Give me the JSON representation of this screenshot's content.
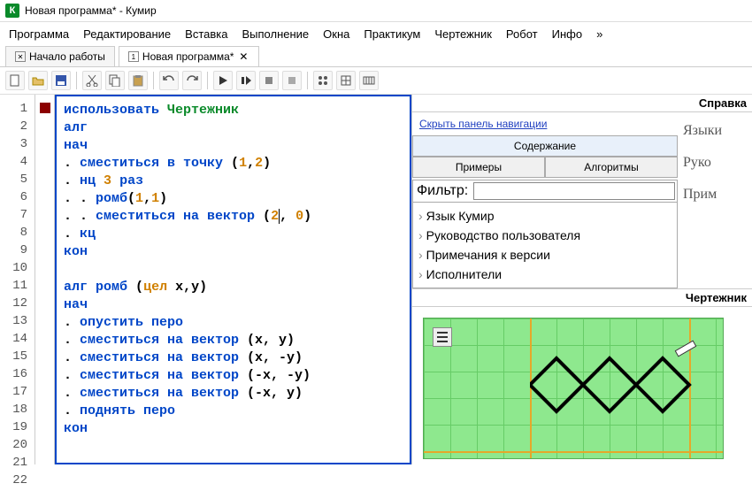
{
  "window": {
    "icon": "К",
    "title": "Новая программа* - Кумир"
  },
  "menu": [
    "Программа",
    "Редактирование",
    "Вставка",
    "Выполнение",
    "Окна",
    "Практикум",
    "Чертежник",
    "Робот",
    "Инфо",
    "»"
  ],
  "tabs": [
    {
      "icon": "✕",
      "label": "Начало работы",
      "active": false,
      "closable": false
    },
    {
      "icon": "1",
      "label": "Новая программа*",
      "active": true,
      "closable": true
    }
  ],
  "toolbar_icons": [
    "new",
    "open",
    "save",
    "cut",
    "copy",
    "paste",
    "undo",
    "redo",
    "run",
    "step",
    "stop",
    "stop2",
    "breakpoints",
    "vars",
    "counter"
  ],
  "editor": {
    "line_count": 22,
    "lines": [
      [
        {
          "t": "использовать",
          "c": "kw"
        },
        {
          "t": " ",
          "c": ""
        },
        {
          "t": "Чертежник",
          "c": "actor"
        }
      ],
      [
        {
          "t": "алг",
          "c": "kw"
        }
      ],
      [
        {
          "t": "нач",
          "c": "kw"
        }
      ],
      [
        {
          "t": ". ",
          "c": "pun"
        },
        {
          "t": "сместиться в точку",
          "c": "kw"
        },
        {
          "t": " (",
          "c": "pun"
        },
        {
          "t": "1",
          "c": "num"
        },
        {
          "t": ",",
          "c": "pun"
        },
        {
          "t": "2",
          "c": "num"
        },
        {
          "t": ")",
          "c": "pun"
        }
      ],
      [
        {
          "t": ". ",
          "c": "pun"
        },
        {
          "t": "нц",
          "c": "kw"
        },
        {
          "t": " ",
          "c": ""
        },
        {
          "t": "3",
          "c": "num"
        },
        {
          "t": " ",
          "c": ""
        },
        {
          "t": "раз",
          "c": "kw"
        }
      ],
      [
        {
          "t": ". . ",
          "c": "pun"
        },
        {
          "t": "ромб",
          "c": "kw"
        },
        {
          "t": "(",
          "c": "pun"
        },
        {
          "t": "1",
          "c": "num"
        },
        {
          "t": ",",
          "c": "pun"
        },
        {
          "t": "1",
          "c": "num"
        },
        {
          "t": ")",
          "c": "pun"
        }
      ],
      [
        {
          "t": ". . ",
          "c": "pun"
        },
        {
          "t": "сместиться на вектор",
          "c": "kw"
        },
        {
          "t": " (",
          "c": "pun"
        },
        {
          "t": "2",
          "c": "num cursor"
        },
        {
          "t": ", ",
          "c": "pun"
        },
        {
          "t": "0",
          "c": "num"
        },
        {
          "t": ")",
          "c": "pun"
        }
      ],
      [
        {
          "t": ". ",
          "c": "pun"
        },
        {
          "t": "кц",
          "c": "kw"
        }
      ],
      [
        {
          "t": "кон",
          "c": "kw"
        }
      ],
      [],
      [
        {
          "t": "алг",
          "c": "kw"
        },
        {
          "t": " ",
          "c": ""
        },
        {
          "t": "ромб",
          "c": "kw"
        },
        {
          "t": " (",
          "c": "pun"
        },
        {
          "t": "цел",
          "c": "type"
        },
        {
          "t": " x,y)",
          "c": "pun"
        }
      ],
      [
        {
          "t": "нач",
          "c": "kw"
        }
      ],
      [
        {
          "t": ". ",
          "c": "pun"
        },
        {
          "t": "опустить перо",
          "c": "kw"
        }
      ],
      [
        {
          "t": ". ",
          "c": "pun"
        },
        {
          "t": "сместиться на вектор",
          "c": "kw"
        },
        {
          "t": " (x, y)",
          "c": "pun"
        }
      ],
      [
        {
          "t": ". ",
          "c": "pun"
        },
        {
          "t": "сместиться на вектор",
          "c": "kw"
        },
        {
          "t": " (x, -y)",
          "c": "pun"
        }
      ],
      [
        {
          "t": ". ",
          "c": "pun"
        },
        {
          "t": "сместиться на вектор",
          "c": "kw"
        },
        {
          "t": " (-x, -y)",
          "c": "pun"
        }
      ],
      [
        {
          "t": ". ",
          "c": "pun"
        },
        {
          "t": "сместиться на вектор",
          "c": "kw"
        },
        {
          "t": " (-x, y)",
          "c": "pun"
        }
      ],
      [
        {
          "t": ". ",
          "c": "pun"
        },
        {
          "t": "поднять перо",
          "c": "kw"
        }
      ],
      [
        {
          "t": "кон",
          "c": "kw"
        }
      ]
    ]
  },
  "help": {
    "title": "Справка",
    "nav_link": "Скрыть панель навигации",
    "btn_content": "Содержание",
    "btn_examples": "Примеры",
    "btn_algs": "Алгоритмы",
    "filter_label": "Фильтр:",
    "tree": [
      "Язык Кумир",
      "Руководство пользователя",
      "Примечания к версии",
      "Исполнители"
    ],
    "preview": [
      "Языки",
      "Руко",
      "Прим"
    ]
  },
  "drawer": {
    "title": "Чертежник"
  }
}
